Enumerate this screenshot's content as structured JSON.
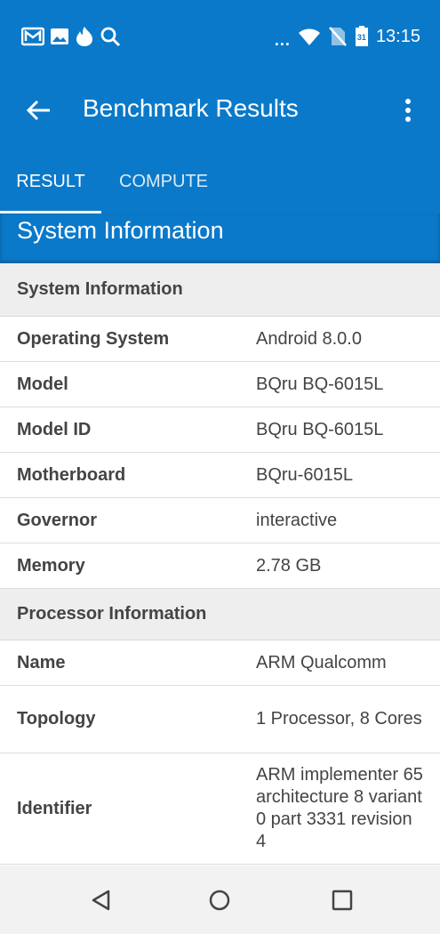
{
  "status_bar": {
    "time": "13:15",
    "calendar_day": "31",
    "more_dots": "...",
    "left_icons": [
      "mail-icon",
      "image-icon",
      "fire-icon",
      "search-icon"
    ],
    "right_icons": [
      "wifi-icon",
      "no-sim-icon",
      "calendar-icon"
    ]
  },
  "appbar": {
    "title": "Benchmark Results"
  },
  "tabs": [
    {
      "label": "RESULT",
      "active": true
    },
    {
      "label": "COMPUTE",
      "active": false
    }
  ],
  "section_title": "System Information",
  "groups": [
    {
      "header": "System Information",
      "rows": [
        {
          "label": "Operating System",
          "value": "Android 8.0.0"
        },
        {
          "label": "Model",
          "value": "BQru BQ-6015L"
        },
        {
          "label": "Model ID",
          "value": "BQru BQ-6015L"
        },
        {
          "label": "Motherboard",
          "value": "BQru-6015L"
        },
        {
          "label": "Governor",
          "value": "interactive"
        },
        {
          "label": "Memory",
          "value": "2.78 GB"
        }
      ]
    },
    {
      "header": "Processor Information",
      "rows": [
        {
          "label": "Name",
          "value": "ARM Qualcomm"
        },
        {
          "label": "Topology",
          "value": "1 Processor, 8 Cores"
        },
        {
          "label": "Identifier",
          "value": "ARM implementer 65 architecture 8 variant 0 part 3331 revision 4"
        }
      ]
    }
  ],
  "colors": {
    "primary": "#0b79c9",
    "header_bg": "#eeeeee",
    "text": "#444444"
  }
}
